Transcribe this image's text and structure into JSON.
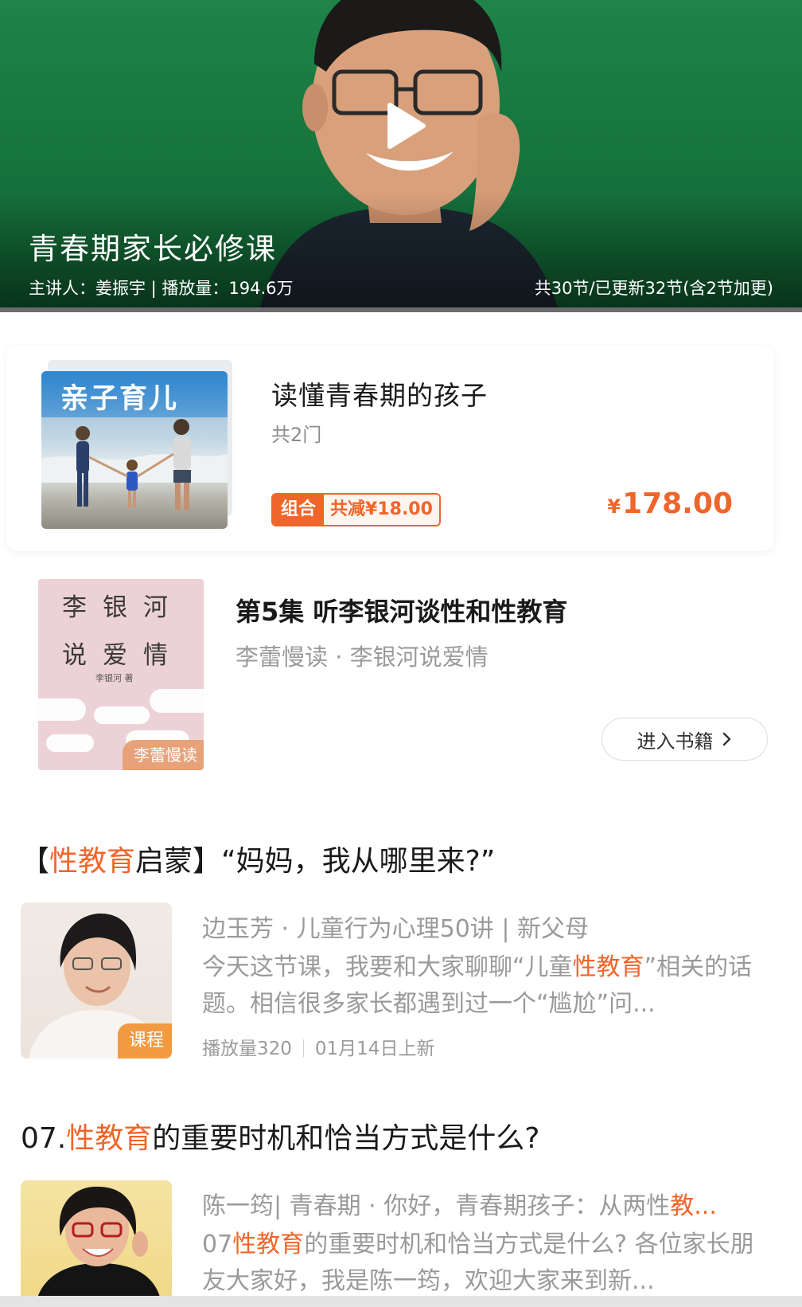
{
  "hero": {
    "title": "青春期家长必修课",
    "meta_left": "主讲人：姜振宇 | 播放量：194.6万",
    "meta_right": "共30节/已更新32节(含2节加更)",
    "bg_color": "#1e8448",
    "icon": "play-icon"
  },
  "bundle": {
    "cover_label": "亲子育儿",
    "title": "读懂青春期的孩子",
    "count": "共2门",
    "tag_left": "组合",
    "tag_right": "共减¥18.00",
    "price_currency": "¥",
    "price_amount": "178.00",
    "accent_color": "#f0652a"
  },
  "book": {
    "cover_line1": "李银河",
    "cover_line2": "说爱情",
    "cover_author": "李银河 著",
    "cover_badge": "李蕾慢读",
    "title": "第5集 听李银河谈性和性教育",
    "subtitle": "李蕾慢读 · 李银河说爱情",
    "enter_label": "进入书籍",
    "enter_icon": "chevron-right-icon"
  },
  "articles": [
    {
      "title_prefix": "【",
      "title_highlight": "性教育",
      "title_suffix": "启蒙】“妈妈，我从哪里来?”",
      "meta": "边玉芳 · 儿童行为心理50讲 | 新父母",
      "desc_pre": "今天这节课，我要和大家聊聊“儿童",
      "desc_highlight": "性教育",
      "desc_post": "”相关的话题。相信很多家长都遇到过一个“尴尬”问...",
      "badge": "课程",
      "plays": "播放量320",
      "date": "01月14日上新"
    },
    {
      "title_prefix": "07.",
      "title_highlight": "性教育",
      "title_suffix": "的重要时机和恰当方式是什么?",
      "meta_pre": "陈一筠| 青春期 · 你好，青春期孩子：从两性",
      "meta_highlight": "教...",
      "desc_pre": "07",
      "desc_highlight": "性教育",
      "desc_post": "的重要时机和恰当方式是什么? 各位家长朋友大家好，我是陈一筠，欢迎大家来到新..."
    }
  ]
}
